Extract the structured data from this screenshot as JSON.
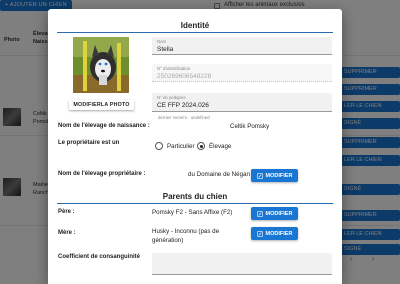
{
  "background": {
    "add_button": "+ AJOUTER UN CHIEN",
    "checkbox_label": "Afficher les animaux exclus/os",
    "col_photo": "Photo",
    "col_elevage": "Élevage",
    "col_elevage_2": "Naiss…",
    "rows": [
      {
        "name": "Celtik",
        "sub": "Pomsk"
      },
      {
        "name": "Maine",
        "sub": "Ranch"
      }
    ],
    "side_buttons": [
      "SUPPRIMER",
      "SUPPRIMER",
      "LER LE CHIEN",
      "SIGNÉ",
      "SUPPRIMER",
      "LER LE CHIEN",
      "SIGNÉ",
      "SUPPRIMER",
      "LER LE CHIEN",
      "SIGNÉ"
    ],
    "pagination": {
      "prev": "‹",
      "next": "›"
    }
  },
  "dialog": {
    "identite_title": "Identité",
    "modify_photo_label": "MODIFIERLA PHOTO",
    "nom": {
      "label": "Nom",
      "value": "Stella"
    },
    "identification": {
      "label": "N° d'identification",
      "value": "250269606548228"
    },
    "pedigree": {
      "label": "N° de pedigree",
      "value": "CE FFP 2024.026"
    },
    "pedigree_helper": "dernier numéro : undefined",
    "elevage_naissance": {
      "label": "Nom de l'élevage de naissance :",
      "value": "Celtik Pomsky"
    },
    "proprietaire": {
      "label": "Le propriétaire est un",
      "option_particulier": "Particulier",
      "option_elevage": "Élevage",
      "selected": "Élevage"
    },
    "elevage_proprietaire": {
      "label": "Nom de l'élevage propriétaire :",
      "value": "du Domaine de Négan"
    },
    "modifier_label": "MODIFIER",
    "parents_title": "Parents du chien",
    "pere": {
      "label": "Père :",
      "value": "Pomsky F2 - Sans Affixe (F2)"
    },
    "mere": {
      "label": "Mère :",
      "value_line1": "Husky - Inconnu (pas de",
      "value_line2": "génération)"
    },
    "coef_label": "Coefficient de consanguinité",
    "colors": {
      "accent": "#1976d2",
      "line": "#2b6cb0"
    },
    "icons": {
      "edit": "pencil-icon"
    }
  }
}
